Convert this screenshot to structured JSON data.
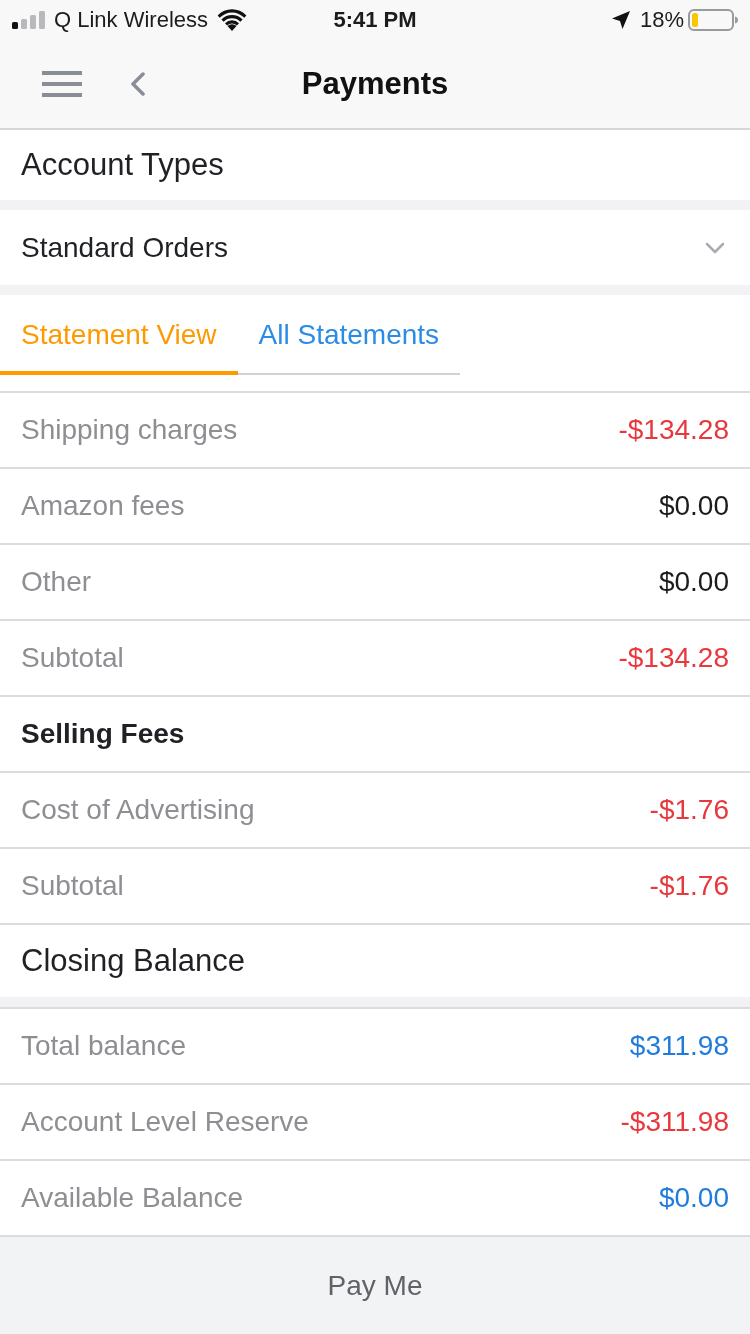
{
  "status_bar": {
    "carrier": "Q Link Wireless",
    "time": "5:41 PM",
    "battery": "18%"
  },
  "nav_bar": {
    "title": "Payments"
  },
  "account_types": {
    "title": "Account Types"
  },
  "account_dropdown": {
    "value": "Standard Orders"
  },
  "tabs": [
    {
      "label": "Statement View",
      "selected": true
    },
    {
      "label": "All Statements",
      "selected": false
    }
  ],
  "statement": [
    {
      "kind": "line",
      "label": "Shipping charges",
      "amount": "-$134.28",
      "color": "#e8383d"
    },
    {
      "kind": "line",
      "label": "Amazon fees",
      "amount": "$0.00",
      "color": "#1c1c1e"
    },
    {
      "kind": "line",
      "label": "Other",
      "amount": "$0.00",
      "color": "#1c1c1e"
    },
    {
      "kind": "line",
      "label": "Subtotal",
      "amount": "-$134.28",
      "color": "#e8383d"
    },
    {
      "kind": "heading",
      "label": "Selling Fees"
    },
    {
      "kind": "line",
      "label": "Cost of Advertising",
      "amount": "-$1.76",
      "color": "#e8383d"
    },
    {
      "kind": "line",
      "label": "Subtotal",
      "amount": "-$1.76",
      "color": "#e8383d"
    }
  ],
  "closing_balance": {
    "title": "Closing Balance",
    "rows": [
      {
        "label": "Total balance",
        "amount": "$311.98",
        "color": "#1f7bdc"
      },
      {
        "label": "Account Level Reserve",
        "amount": "-$311.98",
        "color": "#e8383d"
      },
      {
        "label": "Available Balance",
        "amount": "$0.00",
        "color": "#1f7bdc"
      }
    ]
  },
  "pay_button": {
    "label": "Pay Me"
  }
}
